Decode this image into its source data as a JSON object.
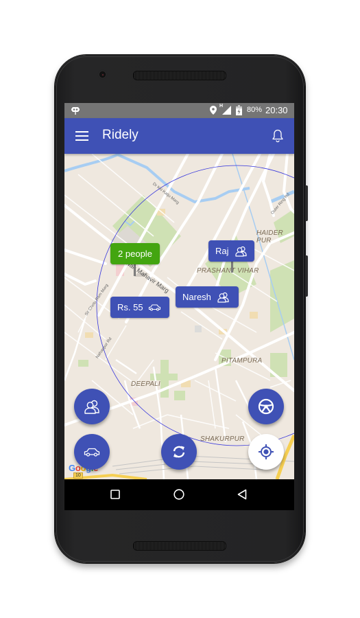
{
  "status_bar": {
    "notification_icon": "cyanogen-bot-icon",
    "location_icon": "location-pin-icon",
    "network_type": "H",
    "signal_icon": "signal-icon",
    "battery_icon": "battery-charging-icon",
    "battery": "80%",
    "time": "20:30"
  },
  "app_bar": {
    "menu_icon": "hamburger-menu-icon",
    "title": "Ridely",
    "notification_icon": "bell-icon"
  },
  "map": {
    "markers": [
      {
        "label": "2 people",
        "color": "#43A510",
        "icon": null
      },
      {
        "label": "Raj",
        "color": "#3F51B5",
        "icon": "people-icon"
      },
      {
        "label": "Naresh",
        "color": "#3F51B5",
        "icon": "people-icon"
      },
      {
        "label": "Rs. 55",
        "color": "#3F51B5",
        "icon": "car-icon"
      }
    ],
    "places": [
      "HAIDER PUR",
      "PRASHANT VIHAR",
      "PITAMPURA",
      "DEEPALI",
      "SHAKURPUR"
    ],
    "roads": [
      "Dr KN Katju Marg",
      "Outer Ring Rd",
      "Bhagwan Mahavir Marg",
      "Sir Chotu Ram Marg",
      "Nahanpur Rd"
    ],
    "attribution": "Google",
    "route_shield": "10",
    "radius_circle_color": "#3333dd"
  },
  "fabs": {
    "passengers": {
      "icon": "people-icon"
    },
    "rides": {
      "icon": "car-icon"
    },
    "refresh": {
      "icon": "refresh-icon"
    },
    "drive": {
      "icon": "steering-wheel-icon"
    },
    "my_location": {
      "icon": "gps-target-icon"
    }
  },
  "nav_bar": {
    "recents_icon": "square-recents-icon",
    "home_icon": "circle-home-icon",
    "back_icon": "triangle-back-icon"
  },
  "colors": {
    "primary": "#3F51B5",
    "accent_green": "#43A510",
    "status_bar": "#757575",
    "map_bg": "#efe8df"
  }
}
